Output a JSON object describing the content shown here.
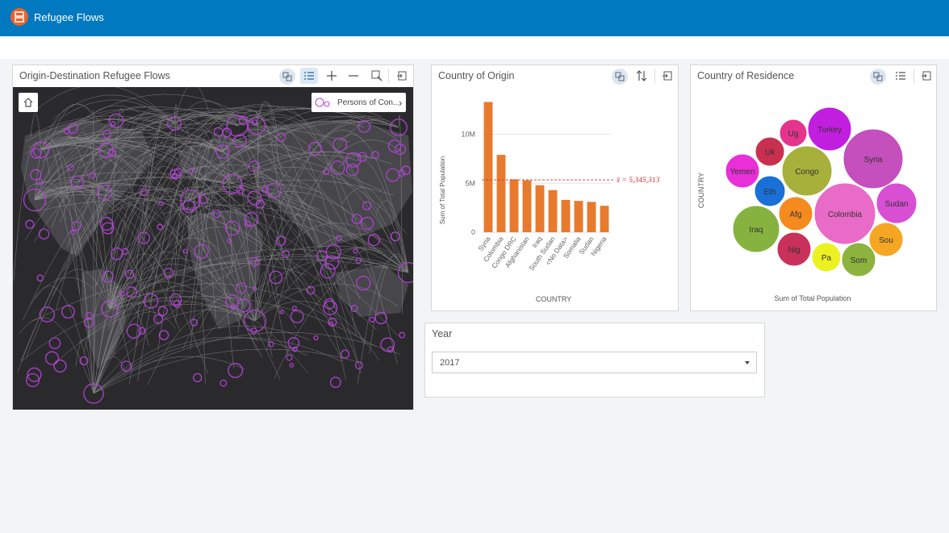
{
  "app": {
    "title": "Refugee Flows"
  },
  "colors": {
    "header": "#0079c1",
    "bar": "#e87a2e",
    "mean_line": "#cc3333",
    "map_bg": "#2a2a2d",
    "circle": "#b742d9"
  },
  "map_card": {
    "title": "Origin-Destination Refugee Flows",
    "icons": [
      "layer-icon",
      "list-icon",
      "zoom-in-icon",
      "zoom-out-icon",
      "zoom-extent-icon",
      "expand-icon"
    ],
    "legend_label": "Persons of Con..."
  },
  "origin_card": {
    "title": "Country of Origin",
    "icons": [
      "layer-icon",
      "sort-icon",
      "expand-icon"
    ],
    "mean_label": "x̄ = 5,345,313"
  },
  "residence_card": {
    "title": "Country of Residence",
    "icons": [
      "layer-icon",
      "list-icon",
      "expand-icon"
    ],
    "ylabel": "COUNTRY",
    "xlabel": "Sum of Total Population",
    "bubbles": [
      {
        "label": "Turkey",
        "color": "#c21ee0"
      },
      {
        "label": "Ug",
        "color": "#e5348c"
      },
      {
        "label": "Uk",
        "color": "#c9304f"
      },
      {
        "label": "Congo",
        "color": "#a7b03a"
      },
      {
        "label": "Syria",
        "color": "#c44fbd"
      },
      {
        "label": "Yemen",
        "color": "#e82fd8"
      },
      {
        "label": "Eth",
        "color": "#1a6fd9"
      },
      {
        "label": "Sudan",
        "color": "#d84fd3"
      },
      {
        "label": "Afg",
        "color": "#f58a1f"
      },
      {
        "label": "Colombia",
        "color": "#e86bc7"
      },
      {
        "label": "Iraq",
        "color": "#86b33f"
      },
      {
        "label": "Sou",
        "color": "#f5a623"
      },
      {
        "label": "Nig",
        "color": "#c9305a"
      },
      {
        "label": "Pa",
        "color": "#ecf121"
      },
      {
        "label": "Som",
        "color": "#8db33f"
      }
    ]
  },
  "year_card": {
    "title": "Year",
    "selected": "2017"
  },
  "chart_data": {
    "type": "bar",
    "categories": [
      "Syria",
      "Colombia",
      "Congo DRC",
      "Afghanistan",
      "Iraq",
      "South Sudan",
      "<No Data>",
      "Somalia",
      "Sudan",
      "Nigeria"
    ],
    "values": [
      13.3,
      7.9,
      5.4,
      5.3,
      4.8,
      4.3,
      3.3,
      3.2,
      3.1,
      2.7
    ],
    "mean": 5.345313,
    "yticks": [
      "0",
      "5M",
      "10M"
    ],
    "ytick_values": [
      0,
      5,
      10
    ],
    "ylim": [
      0,
      14
    ],
    "xlabel": "COUNTRY",
    "ylabel": "Sum of Total Population"
  }
}
